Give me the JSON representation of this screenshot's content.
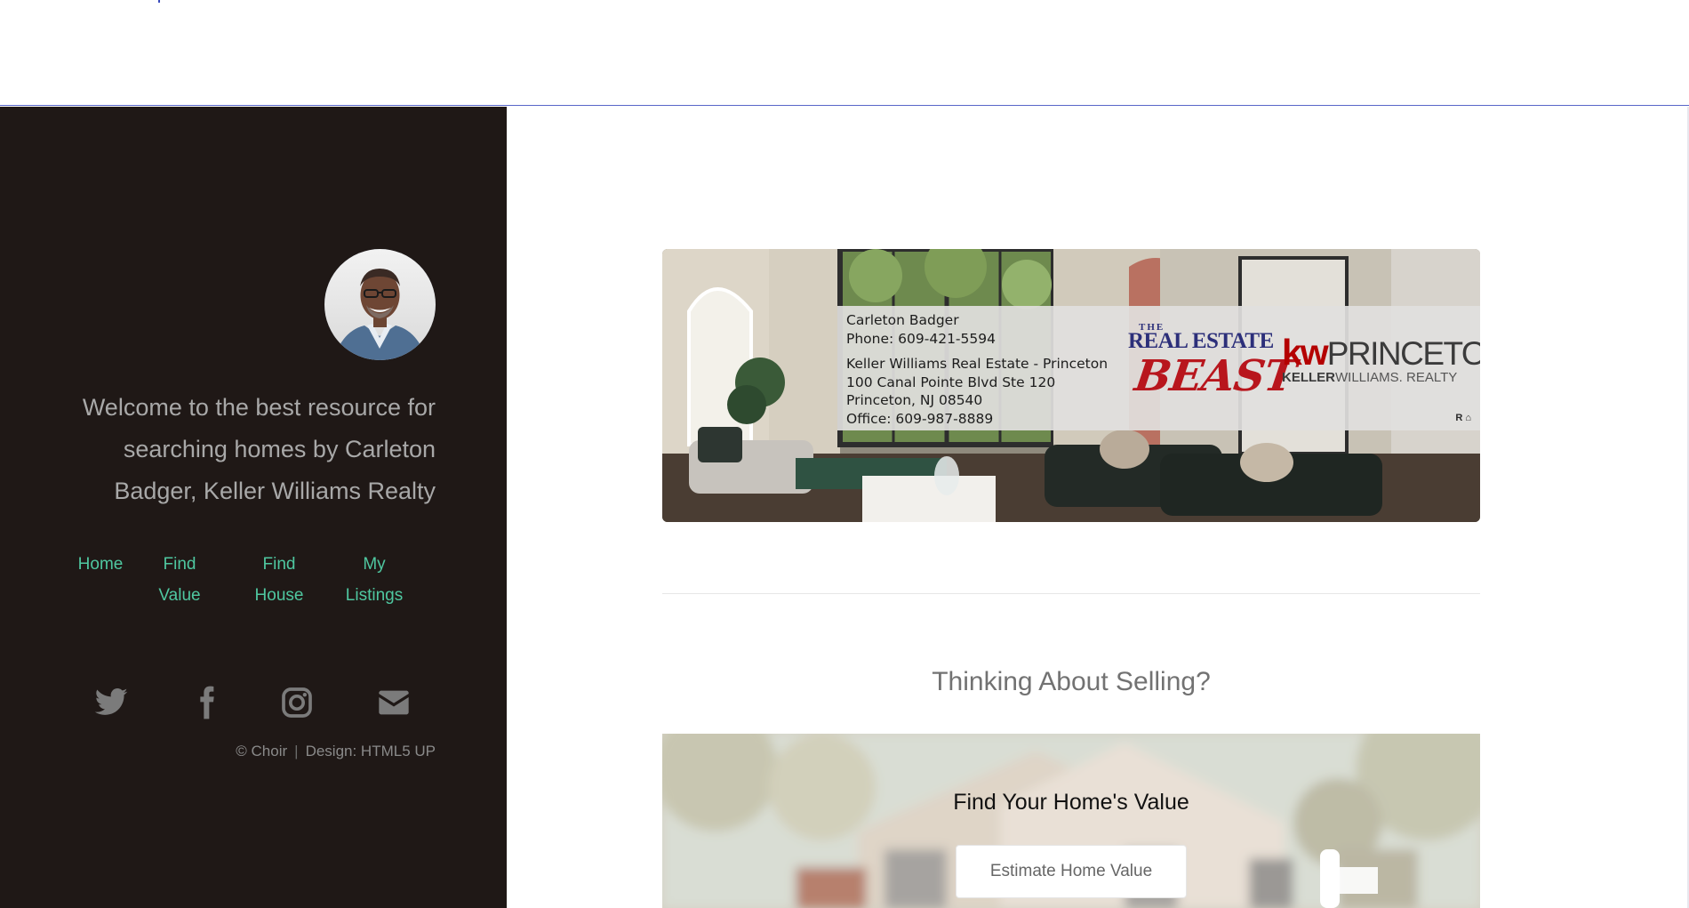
{
  "sidebar": {
    "welcome": "Welcome to the best resource for searching homes by Carleton Badger, Keller Williams Realty",
    "nav": [
      {
        "line1": "Home",
        "line2": ""
      },
      {
        "line1": "Find",
        "line2": "Value"
      },
      {
        "line1": "Find",
        "line2": "House"
      },
      {
        "line1": "My",
        "line2": "Listings"
      }
    ],
    "social_icons": [
      "twitter-icon",
      "facebook-icon",
      "instagram-icon",
      "envelope-icon"
    ],
    "credits": {
      "copyright": "© Choir",
      "separator": "|",
      "design": "Design: HTML5 UP"
    }
  },
  "banner": {
    "agent_name": "Carleton Badger",
    "agent_phone": "Phone: 609-421-5594",
    "office_name": "Keller Williams Real Estate - Princeton",
    "address1": "100 Canal Pointe Blvd Ste 120",
    "address2": "Princeton, NJ 08540",
    "office_phone": "Office: 609-987-8889",
    "logo_the": "THE",
    "logo_real_estate": "REAL ESTATE",
    "logo_beast": "BEAST",
    "kw_mark": "kw",
    "kw_city": "PRINCETON",
    "kw_sub_bold": "KELLER",
    "kw_sub_rest": "WILLIAMS. REALTY"
  },
  "selling": {
    "title": "Thinking About Selling?",
    "box_title": "Find Your Home's Value",
    "button_label": "Estimate Home Value"
  },
  "colors": {
    "sidebar_bg": "#1f1816",
    "nav_link": "#4fc7a0",
    "welcome_text": "#a8a8a8",
    "divider_line": "#5866c9"
  }
}
